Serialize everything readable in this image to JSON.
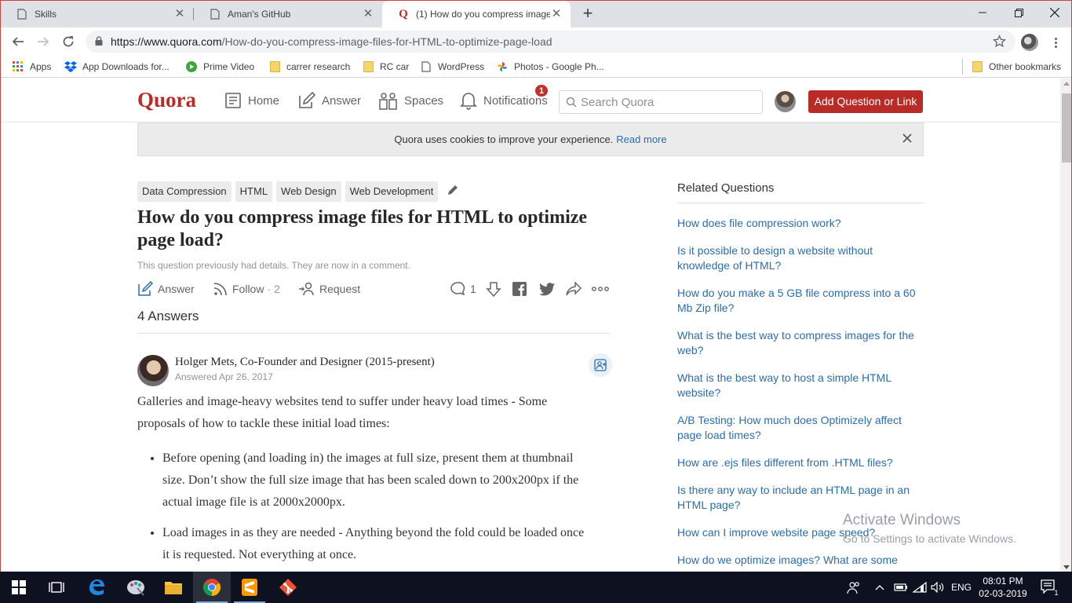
{
  "browser": {
    "tabs": [
      {
        "title": "Skills",
        "icon": "page-icon"
      },
      {
        "title": "Aman's GitHub",
        "icon": "page-icon"
      },
      {
        "title": "(1) How do you compress image",
        "icon": "quora-icon",
        "active": true
      }
    ],
    "url_host": "https://www.quora.com",
    "url_path": "/How-do-you-compress-image-files-for-HTML-to-optimize-page-load",
    "bookmarks": [
      {
        "label": "Apps",
        "icon": "apps-grid-icon"
      },
      {
        "label": "App Downloads for...",
        "icon": "dropbox-icon"
      },
      {
        "label": "Prime Video",
        "icon": "play-icon"
      },
      {
        "label": "carrer research",
        "icon": "folder-icon"
      },
      {
        "label": "RC car",
        "icon": "folder-icon"
      },
      {
        "label": "WordPress",
        "icon": "page-icon"
      },
      {
        "label": "Photos - Google Ph...",
        "icon": "pinwheel-icon"
      }
    ],
    "other_bookmarks": "Other bookmarks"
  },
  "quora": {
    "logo": "Quora",
    "nav": {
      "home": "Home",
      "answer": "Answer",
      "spaces": "Spaces",
      "notifications": "Notifications",
      "notification_count": "1"
    },
    "search_placeholder": "Search Quora",
    "add_button": "Add Question or Link",
    "accent": "#b92b27",
    "link_color": "#2b6dad"
  },
  "cookie": {
    "text": "Quora uses cookies to improve your experience.",
    "link": "Read more"
  },
  "question": {
    "topics": [
      "Data Compression",
      "HTML",
      "Web Design",
      "Web Development"
    ],
    "title": "How do you compress image files for HTML to optimize page load?",
    "note": "This question previously had details. They are now in a comment.",
    "actions": {
      "answer": "Answer",
      "follow": "Follow",
      "follow_count": "2",
      "request": "Request",
      "comment_count": "1"
    },
    "answers_count": "4 Answers"
  },
  "answer": {
    "author": "Holger Mets, Co-Founder and Designer (2015-present)",
    "date": "Answered Apr 26, 2017",
    "intro": "Galleries and image-heavy websites tend to suffer under heavy load times - Some proposals of how to tackle these initial load times:",
    "points": [
      "Before opening (and loading in) the images at full size, present them at thumbnail size. Don’t show the full size image that has been scaled down to 200x200px if the actual image file is at 2000x2000px.",
      "Load images in as they are needed - Anything beyond the fold could be loaded once it is requested. Not everything at once."
    ]
  },
  "related": {
    "heading": "Related Questions",
    "items": [
      "How does file compression work?",
      "Is it possible to design a website without knowledge of HTML?",
      "How do you make a 5 GB file compress into a 60 Mb Zip file?",
      "What is the best way to compress images for the web?",
      "What is the best way to host a simple HTML website?",
      "A/B Testing: How much does Optimizely affect page load times?",
      "How are .ejs files different from .HTML files?",
      "Is there any way to include an HTML page in an HTML page?",
      "How can I improve website page speed?",
      "How do we optimize images? What are some"
    ]
  },
  "watermark": {
    "line1": "Activate Windows",
    "line2": "Go to Settings to activate Windows."
  },
  "taskbar": {
    "language": "ENG",
    "time": "08:01 PM",
    "date": "02-03-2019",
    "notification_count": "1"
  }
}
